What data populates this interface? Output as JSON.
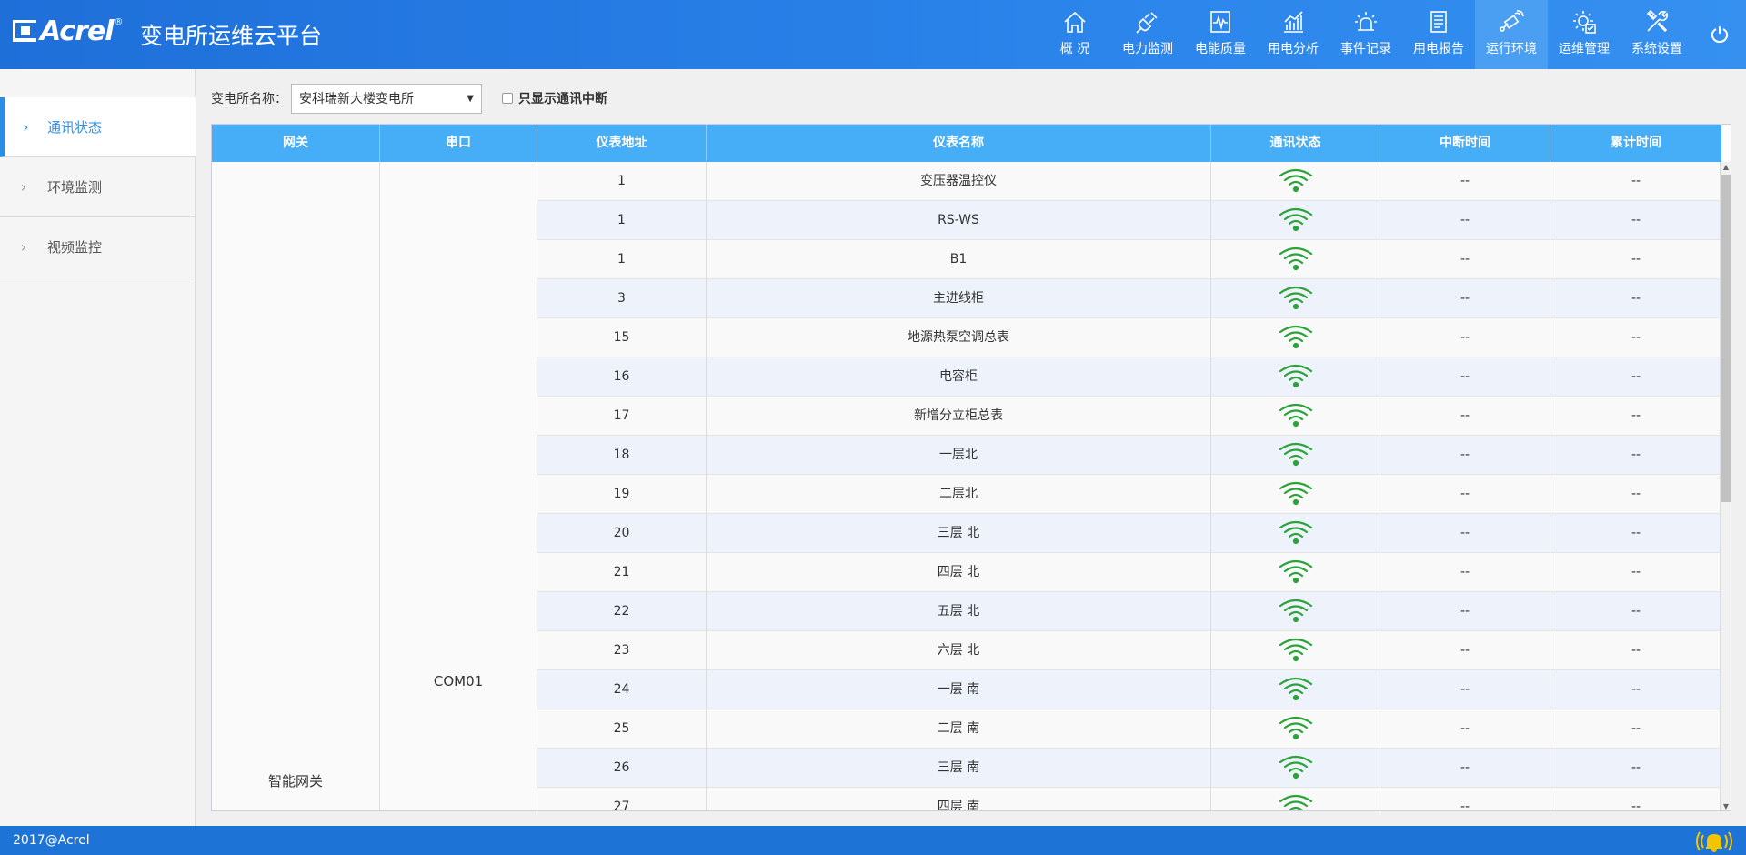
{
  "header": {
    "logo_text": "Acrel",
    "logo_reg": "®",
    "app_title": "变电所运维云平台",
    "nav": [
      {
        "label": "概 况",
        "icon": "home-icon"
      },
      {
        "label": "电力监测",
        "icon": "plug-icon"
      },
      {
        "label": "电能质量",
        "icon": "waveform-icon"
      },
      {
        "label": "用电分析",
        "icon": "bar-chart-icon"
      },
      {
        "label": "事件记录",
        "icon": "alarm-light-icon"
      },
      {
        "label": "用电报告",
        "icon": "report-icon"
      },
      {
        "label": "运行环境",
        "icon": "satellite-icon",
        "active": true
      },
      {
        "label": "运维管理",
        "icon": "gear-check-icon"
      },
      {
        "label": "系统设置",
        "icon": "tools-icon"
      }
    ],
    "power_icon": "power-icon"
  },
  "sidebar": {
    "items": [
      {
        "label": "通讯状态",
        "active": true
      },
      {
        "label": "环境监测"
      },
      {
        "label": "视频监控"
      }
    ]
  },
  "filter": {
    "station_label": "变电所名称：",
    "station_value": "安科瑞新大楼变电所",
    "only_interrupt_label": "只显示通讯中断"
  },
  "table": {
    "columns": [
      "网关",
      "串口",
      "仪表地址",
      "仪表名称",
      "通讯状态",
      "中断时间",
      "累计时间"
    ],
    "gateway": "智能网关",
    "port": "COM01",
    "rows": [
      {
        "addr": "1",
        "name": "变压器温控仪",
        "status": "wifi-connected",
        "interrupt": "--",
        "total": "--"
      },
      {
        "addr": "1",
        "name": "RS-WS",
        "status": "wifi-connected",
        "interrupt": "--",
        "total": "--"
      },
      {
        "addr": "1",
        "name": "B1",
        "status": "wifi-connected",
        "interrupt": "--",
        "total": "--"
      },
      {
        "addr": "3",
        "name": "主进线柜",
        "status": "wifi-connected",
        "interrupt": "--",
        "total": "--"
      },
      {
        "addr": "15",
        "name": "地源热泵空调总表",
        "status": "wifi-connected",
        "interrupt": "--",
        "total": "--"
      },
      {
        "addr": "16",
        "name": "电容柜",
        "status": "wifi-connected",
        "interrupt": "--",
        "total": "--"
      },
      {
        "addr": "17",
        "name": "新增分立柜总表",
        "status": "wifi-connected",
        "interrupt": "--",
        "total": "--"
      },
      {
        "addr": "18",
        "name": "一层北",
        "status": "wifi-connected",
        "interrupt": "--",
        "total": "--"
      },
      {
        "addr": "19",
        "name": "二层北",
        "status": "wifi-connected",
        "interrupt": "--",
        "total": "--"
      },
      {
        "addr": "20",
        "name": "三层 北",
        "status": "wifi-connected",
        "interrupt": "--",
        "total": "--"
      },
      {
        "addr": "21",
        "name": "四层 北",
        "status": "wifi-connected",
        "interrupt": "--",
        "total": "--"
      },
      {
        "addr": "22",
        "name": "五层 北",
        "status": "wifi-connected",
        "interrupt": "--",
        "total": "--"
      },
      {
        "addr": "23",
        "name": "六层 北",
        "status": "wifi-connected",
        "interrupt": "--",
        "total": "--"
      },
      {
        "addr": "24",
        "name": "一层 南",
        "status": "wifi-connected",
        "interrupt": "--",
        "total": "--"
      },
      {
        "addr": "25",
        "name": "二层 南",
        "status": "wifi-connected",
        "interrupt": "--",
        "total": "--"
      },
      {
        "addr": "26",
        "name": "三层 南",
        "status": "wifi-connected",
        "interrupt": "--",
        "total": "--"
      },
      {
        "addr": "27",
        "name": "四层 南",
        "status": "wifi-connected",
        "interrupt": "--",
        "total": "--"
      }
    ]
  },
  "footer": {
    "copyright": "2017@Acrel",
    "bell_icon": "alarm-bell-icon"
  },
  "colors": {
    "header": "#2a84ea",
    "accent": "#2b8de6",
    "table_header": "#46aef6",
    "wifi_ok": "#2aa33a",
    "bell": "#f5c400"
  }
}
